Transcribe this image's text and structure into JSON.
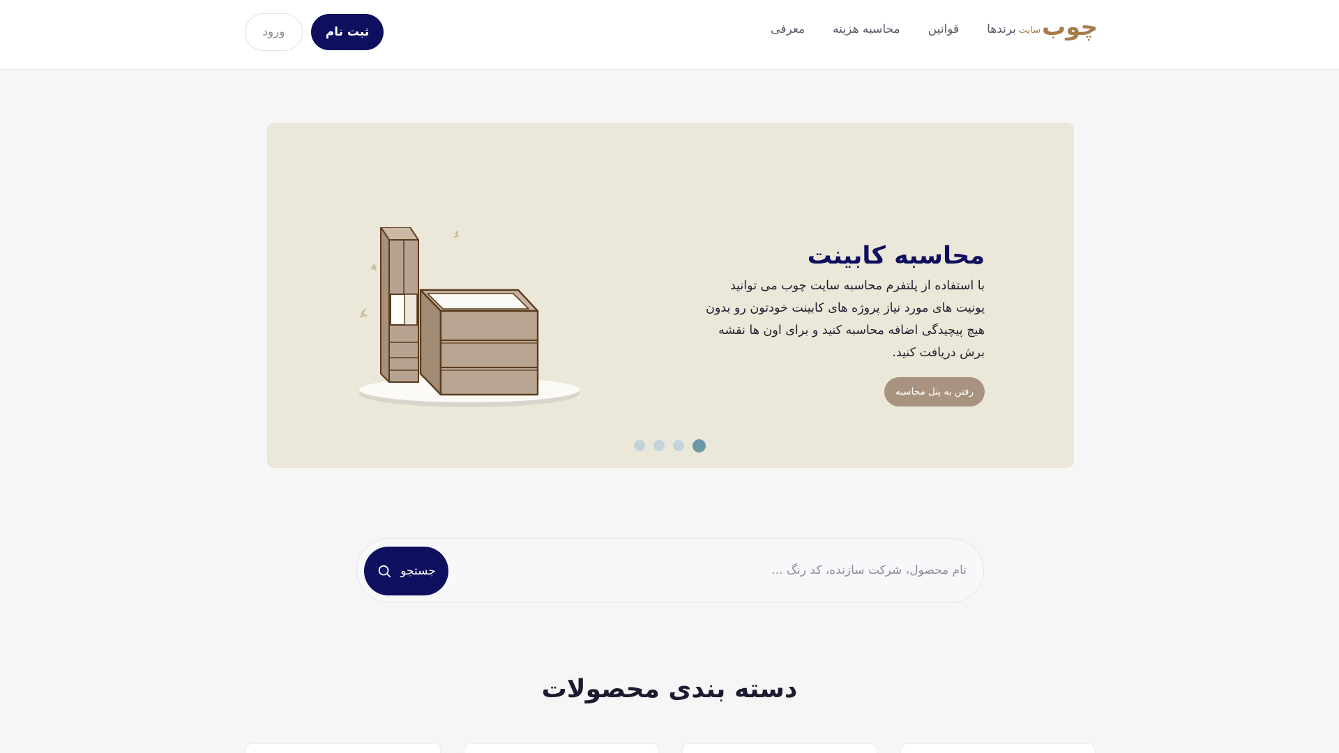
{
  "header": {
    "logo_main": "چوب",
    "logo_sub": "سایت",
    "nav": [
      "برندها",
      "قوانین",
      "محاسبه هزینه",
      "معرفی"
    ],
    "register_label": "ثبت نام",
    "login_label": "ورود"
  },
  "hero": {
    "title": "محاسبه کابینت",
    "description": "با استفاده از پلتفرم محاسبه سایت چوب می توانید یونیت های مورد نیاز پروژه های کابینت خودتون رو بدون هیچ پیچیدگی اضافه محاسبه کنید و برای اون ها نقشه برش دریافت کنید.",
    "button_label": "رفتن به پنل محاسبه",
    "slides_total": 4,
    "active_slide": 4
  },
  "search": {
    "placeholder": "نام محصول، شرکت سازنده، کد رنگ ...",
    "value": "",
    "button_label": "جستجو"
  },
  "categories": {
    "title": "دسته بندی محصولات"
  },
  "colors": {
    "primary": "#0e0f5e",
    "brand": "#a67c4b",
    "hero_bg": "#ebe7d9",
    "hero_button": "#a89380",
    "dot_active": "#6a9aa7",
    "dot_inactive": "#c2d3da"
  }
}
